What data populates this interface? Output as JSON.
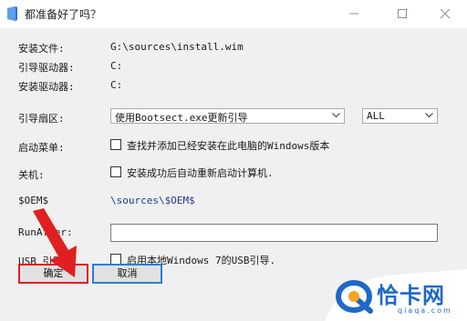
{
  "window": {
    "title": "都准备好了吗？",
    "minimize_icon": "minimize-icon",
    "maximize_icon": "maximize-icon",
    "close_icon": "close-icon"
  },
  "info": {
    "install_file_label": "安装文件:",
    "install_file_value": "G:\\sources\\install.wim",
    "boot_drive_label": "引导驱动器:",
    "boot_drive_value": "C:",
    "install_drive_label": "安装驱动器:",
    "install_drive_value": "C:"
  },
  "boot_sector": {
    "label": "引导扇区:",
    "selected": "使用Bootsect.exe更新引导",
    "target": "ALL"
  },
  "boot_menu": {
    "label": "启动菜单:",
    "checkbox_label": "查找并添加已经安装在此电脑的Windows版本",
    "checked": false
  },
  "shutdown": {
    "label": "关机:",
    "checkbox_label": "安装成功后自动重新启动计算机.",
    "checked": false
  },
  "oem": {
    "label": "$OEM$",
    "value": "\\sources\\$OEM$"
  },
  "run_after": {
    "label": "RunAfter:",
    "value": ""
  },
  "usb_boot": {
    "label": "USB 引导:",
    "checkbox_label": "启用本地Windows 7的USB引导.",
    "checked": false
  },
  "buttons": {
    "ok": "确定",
    "cancel": "取消"
  },
  "watermark": {
    "name": "恰卡网",
    "url": "qiaqa.com"
  },
  "colors": {
    "annotation_red": "#e02020",
    "focus_blue": "#2a7fd4",
    "oem_blue": "#1e3a96",
    "brand_blue": "#1f68c7"
  }
}
